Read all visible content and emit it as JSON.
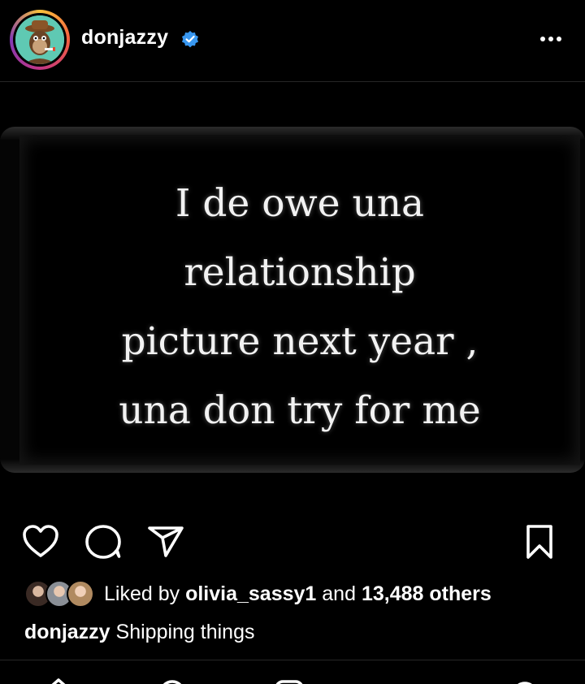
{
  "post": {
    "username": "donjazzy",
    "verified": true,
    "meme_lines": [
      "I de owe una",
      "relationship",
      "picture next year ,",
      "una don try for me"
    ],
    "likes": {
      "prefix": "Liked by",
      "user": "olivia_sassy1",
      "connector": "and",
      "count": "13,488 others"
    },
    "caption": {
      "username": "donjazzy",
      "text": "Shipping things"
    }
  },
  "icons": {
    "more": "more-icon",
    "like": "heart-icon",
    "comment": "comment-icon",
    "share": "share-icon",
    "save": "bookmark-icon",
    "verified": "verified-badge-icon"
  },
  "colors": {
    "background": "#000000",
    "verified": "#3897f0",
    "text": "#ffffff"
  }
}
